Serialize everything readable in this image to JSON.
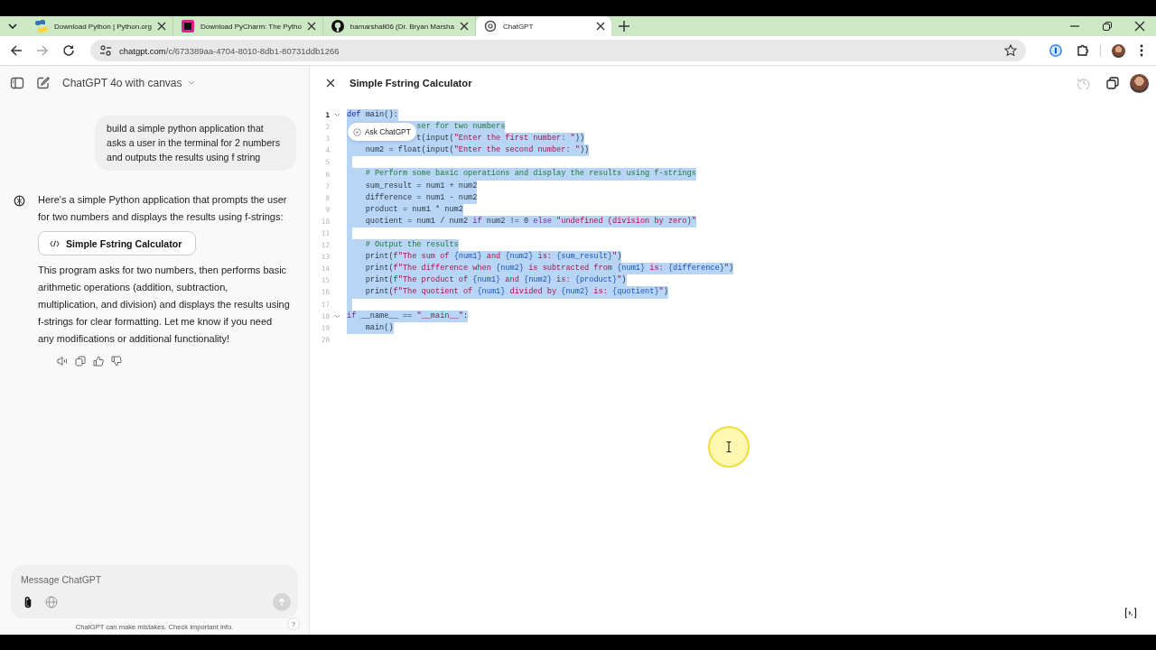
{
  "browser": {
    "tabs": [
      {
        "title": "Download Python | Python.org",
        "selected": false
      },
      {
        "title": "Download PyCharm: The Pytho",
        "selected": false
      },
      {
        "title": "bamarshall06 (Dr. Bryan Marsha",
        "selected": false
      },
      {
        "title": "ChatGPT",
        "selected": true
      }
    ],
    "url": {
      "host": "chatgpt.com",
      "path": "/c/673389aa-4704-8010-8db1-80731ddb1266"
    }
  },
  "chat": {
    "model": "ChatGPT 4o with canvas",
    "messages": [
      {
        "kind": "user",
        "blocks": [
          {
            "kind": "paragraph",
            "text": "build a simple python application that asks a user in the terminal for 2 numbers and outputs the results using f string"
          }
        ]
      },
      {
        "kind": "assistant",
        "blocks": [
          {
            "kind": "paragraph",
            "text": "Here's a simple Python application that prompts the user for two numbers and displays the results using f-strings:"
          },
          {
            "kind": "canvas_link",
            "text": "Simple Fstring Calculator"
          },
          {
            "kind": "paragraph",
            "text": "This program asks for two numbers, then performs basic arithmetic operations (addition, subtraction, multiplication, and division) and displays the results using f-strings for clear formatting. Let me know if you need any modifications or additional functionality!"
          }
        ]
      }
    ],
    "composer": {
      "placeholder": "Message ChatGPT"
    },
    "disclaimer": "ChatGPT can make mistakes. Check important info.",
    "help": "?"
  },
  "canvas": {
    "title": "Simple Fstring Calculator",
    "popup": "Ask ChatGPT",
    "lines": [
      {
        "number": "1",
        "selected": true,
        "current": true,
        "foldable": true,
        "tokens": [
          {
            "text": "def",
            "kind": "keyword"
          },
          {
            "text": " main():",
            "kind": "plain"
          }
        ]
      },
      {
        "number": "2",
        "selected": true,
        "current": false,
        "foldable": false,
        "tokens": [
          {
            "text": "               ser for two numbers",
            "kind": "comment"
          }
        ]
      },
      {
        "number": "3",
        "selected": true,
        "current": false,
        "foldable": false,
        "tokens": [
          {
            "text": "               t(input(",
            "kind": "plain"
          },
          {
            "text": "\"Enter the first number: \"",
            "kind": "string"
          },
          {
            "text": "))",
            "kind": "plain"
          }
        ]
      },
      {
        "number": "4",
        "selected": true,
        "current": false,
        "foldable": false,
        "tokens": [
          {
            "text": "    num2 = float(input(",
            "kind": "plain"
          },
          {
            "text": "\"Enter the second number: \"",
            "kind": "string"
          },
          {
            "text": "))",
            "kind": "plain"
          }
        ]
      },
      {
        "number": "5",
        "selected": true,
        "current": false,
        "foldable": false
      },
      {
        "number": "6",
        "selected": true,
        "current": false,
        "foldable": false,
        "tokens": [
          {
            "text": "    # Perform some basic operations and display the results using f-strings",
            "kind": "comment"
          }
        ]
      },
      {
        "number": "7",
        "selected": true,
        "current": false,
        "foldable": false,
        "tokens": [
          {
            "text": "    sum_result = num1 + num2",
            "kind": "plain"
          }
        ]
      },
      {
        "number": "8",
        "selected": true,
        "current": false,
        "foldable": false,
        "tokens": [
          {
            "text": "    difference = num1 - num2",
            "kind": "plain"
          }
        ]
      },
      {
        "number": "9",
        "selected": true,
        "current": false,
        "foldable": false,
        "tokens": [
          {
            "text": "    product = num1 * num2",
            "kind": "plain"
          }
        ]
      },
      {
        "number": "10",
        "selected": true,
        "current": false,
        "foldable": false,
        "tokens": [
          {
            "text": "    quotient = num1 / num2 ",
            "kind": "plain"
          },
          {
            "text": "if",
            "kind": "control"
          },
          {
            "text": " num2 != 0 ",
            "kind": "plain"
          },
          {
            "text": "else",
            "kind": "control"
          },
          {
            "text": " \"undefined (division by zero)\"",
            "kind": "string"
          }
        ]
      },
      {
        "number": "11",
        "selected": true,
        "current": false,
        "foldable": false
      },
      {
        "number": "12",
        "selected": true,
        "current": false,
        "foldable": false,
        "tokens": [
          {
            "text": "    # Output the results",
            "kind": "comment"
          }
        ]
      },
      {
        "number": "13",
        "selected": true,
        "current": false,
        "foldable": false,
        "tokens": [
          {
            "text": "    print(",
            "kind": "plain"
          },
          {
            "text": "f\"The sum of ",
            "kind": "string"
          },
          {
            "text": "{num1}",
            "kind": "variable"
          },
          {
            "text": " and ",
            "kind": "string"
          },
          {
            "text": "{num2}",
            "kind": "variable"
          },
          {
            "text": " is: ",
            "kind": "string"
          },
          {
            "text": "{sum_result}",
            "kind": "variable"
          },
          {
            "text": "\"",
            "kind": "string"
          },
          {
            "text": ")",
            "kind": "plain"
          }
        ]
      },
      {
        "number": "14",
        "selected": true,
        "current": false,
        "foldable": false,
        "tokens": [
          {
            "text": "    print(",
            "kind": "plain"
          },
          {
            "text": "f\"The difference when ",
            "kind": "string"
          },
          {
            "text": "{num2}",
            "kind": "variable"
          },
          {
            "text": " is subtracted from ",
            "kind": "string"
          },
          {
            "text": "{num1}",
            "kind": "variable"
          },
          {
            "text": " is: ",
            "kind": "string"
          },
          {
            "text": "{difference}",
            "kind": "variable"
          },
          {
            "text": "\"",
            "kind": "string"
          },
          {
            "text": ")",
            "kind": "plain"
          }
        ]
      },
      {
        "number": "15",
        "selected": true,
        "current": false,
        "foldable": false,
        "tokens": [
          {
            "text": "    print(",
            "kind": "plain"
          },
          {
            "text": "f\"The product of ",
            "kind": "string"
          },
          {
            "text": "{num1}",
            "kind": "variable"
          },
          {
            "text": " and ",
            "kind": "string"
          },
          {
            "text": "{num2}",
            "kind": "variable"
          },
          {
            "text": " is: ",
            "kind": "string"
          },
          {
            "text": "{product}",
            "kind": "variable"
          },
          {
            "text": "\"",
            "kind": "string"
          },
          {
            "text": ")",
            "kind": "plain"
          }
        ]
      },
      {
        "number": "16",
        "selected": true,
        "current": false,
        "foldable": false,
        "tokens": [
          {
            "text": "    print(",
            "kind": "plain"
          },
          {
            "text": "f\"The quotient of ",
            "kind": "string"
          },
          {
            "text": "{num1}",
            "kind": "variable"
          },
          {
            "text": " divided by ",
            "kind": "string"
          },
          {
            "text": "{num2}",
            "kind": "variable"
          },
          {
            "text": " is: ",
            "kind": "string"
          },
          {
            "text": "{quotient}",
            "kind": "variable"
          },
          {
            "text": "\"",
            "kind": "string"
          },
          {
            "text": ")",
            "kind": "plain"
          }
        ]
      },
      {
        "number": "17",
        "selected": true,
        "current": false,
        "foldable": false
      },
      {
        "number": "18",
        "selected": true,
        "current": false,
        "foldable": true,
        "tokens": [
          {
            "text": "if",
            "kind": "control"
          },
          {
            "text": " __name__ == ",
            "kind": "plain"
          },
          {
            "text": "\"__main__\"",
            "kind": "string"
          },
          {
            "text": ":",
            "kind": "plain"
          }
        ]
      },
      {
        "number": "19",
        "selected": true,
        "current": false,
        "foldable": false,
        "tokens": [
          {
            "text": "    main()",
            "kind": "plain"
          }
        ]
      },
      {
        "number": "20",
        "selected": false,
        "current": false,
        "foldable": false
      }
    ]
  }
}
